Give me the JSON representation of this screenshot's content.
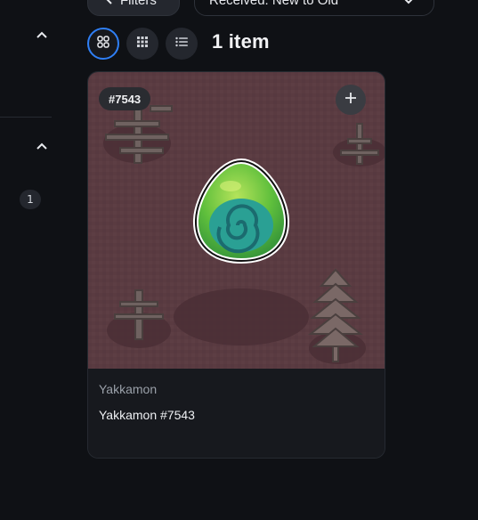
{
  "toolbar": {
    "filters_label": "Filters",
    "sort_value": "Received: New to Old"
  },
  "sidebar": {
    "count": "1"
  },
  "view": {
    "modes": [
      "grid-large",
      "grid-small",
      "list"
    ],
    "active": "grid-large",
    "item_count": "1 item"
  },
  "card": {
    "token_id": "#7543",
    "collection": "Yakkamon",
    "name": "Yakkamon #7543"
  },
  "colors": {
    "accent": "#2f7ff5",
    "background": "#0f1115",
    "card_art_bg": "#5a3b41"
  }
}
